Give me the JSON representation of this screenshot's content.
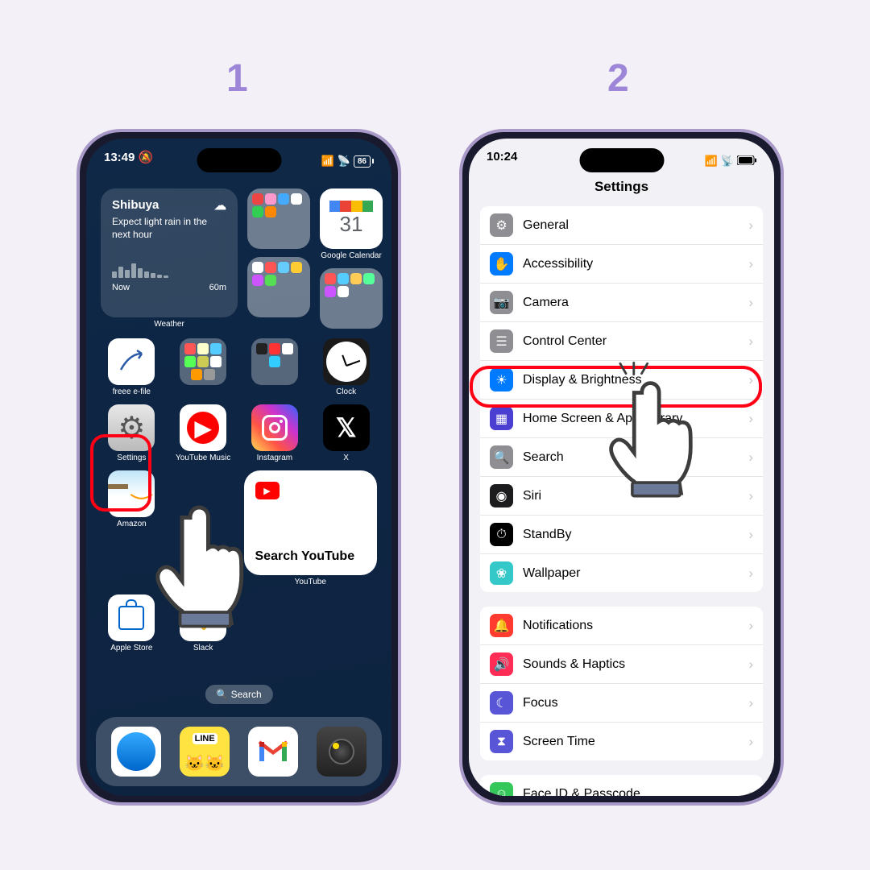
{
  "steps": {
    "one": "1",
    "two": "2"
  },
  "phone1": {
    "status": {
      "time": "13:49",
      "battery": "86"
    },
    "weather": {
      "location": "Shibuya",
      "forecast": "Expect light rain in the next hour",
      "label": "Weather",
      "now": "Now",
      "later": "60m"
    },
    "apps": {
      "gcal": {
        "label": "Google Calendar",
        "day": "31"
      },
      "freee": "freee e-file",
      "clock": "Clock",
      "settings": "Settings",
      "ytmusic": "YouTube Music",
      "instagram": "Instagram",
      "x": "X",
      "amazon": "Amazon",
      "youtube": "YouTube",
      "applestore": "Apple Store",
      "slack": "Slack",
      "ytwidget": "Search YouTube"
    },
    "search": "🔍 Search"
  },
  "phone2": {
    "status": {
      "time": "10:24"
    },
    "title": "Settings",
    "group1": [
      {
        "label": "General",
        "color": "#8e8e93",
        "icon": "⚙"
      },
      {
        "label": "Accessibility",
        "color": "#007aff",
        "icon": "✋"
      },
      {
        "label": "Camera",
        "color": "#8e8e93",
        "icon": "📷"
      },
      {
        "label": "Control Center",
        "color": "#8e8e93",
        "icon": "☰"
      },
      {
        "label": "Display & Brightness",
        "color": "#007aff",
        "icon": "☀"
      },
      {
        "label": "Home Screen & App Library",
        "color": "#4b3fd1",
        "icon": "▦"
      },
      {
        "label": "Search",
        "color": "#8e8e93",
        "icon": "🔍"
      },
      {
        "label": "Siri",
        "color": "#1c1c1e",
        "icon": "◉"
      },
      {
        "label": "StandBy",
        "color": "#000",
        "icon": "⏱"
      },
      {
        "label": "Wallpaper",
        "color": "#34c8c8",
        "icon": "❀"
      }
    ],
    "group2": [
      {
        "label": "Notifications",
        "color": "#ff3b30",
        "icon": "🔔"
      },
      {
        "label": "Sounds & Haptics",
        "color": "#ff2d55",
        "icon": "🔊"
      },
      {
        "label": "Focus",
        "color": "#5856d6",
        "icon": "☾"
      },
      {
        "label": "Screen Time",
        "color": "#5856d6",
        "icon": "⧗"
      }
    ],
    "group3": [
      {
        "label": "Face ID & Passcode",
        "color": "#34c759",
        "icon": "☺"
      }
    ]
  }
}
